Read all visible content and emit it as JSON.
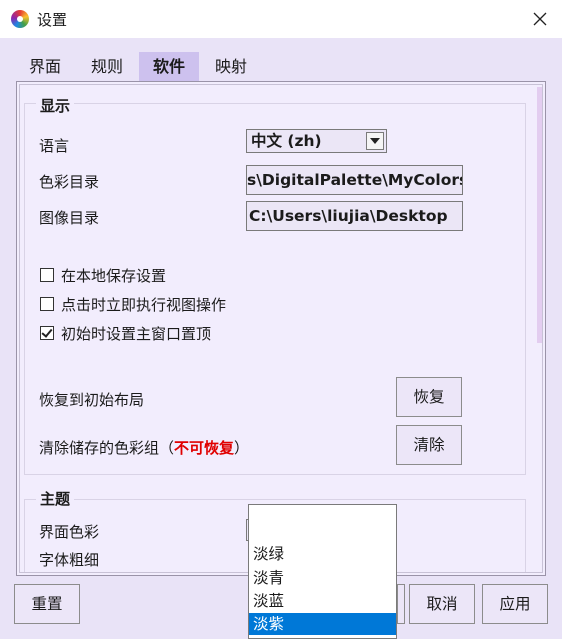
{
  "window": {
    "title": "设置"
  },
  "tabs": [
    {
      "label": "界面"
    },
    {
      "label": "规则"
    },
    {
      "label": "软件",
      "active": true
    },
    {
      "label": "映射"
    }
  ],
  "display_group": {
    "title": "显示",
    "language_label": "语言",
    "language_value": "中文 (zh)",
    "color_dir_label": "色彩目录",
    "color_dir_value": "s\\DigitalPalette\\MyColors",
    "image_dir_label": "图像目录",
    "image_dir_value": "C:\\Users\\liujia\\Desktop",
    "checkboxes": [
      {
        "label": "在本地保存设置",
        "checked": false
      },
      {
        "label": "点击时立即执行视图操作",
        "checked": false
      },
      {
        "label": "初始时设置主窗口置顶",
        "checked": true
      }
    ],
    "restore_label": "恢复到初始布局",
    "restore_button": "恢复",
    "clear_label_prefix": "清除储存的色彩组（",
    "clear_label_warning": "不可恢复",
    "clear_label_suffix": "）",
    "clear_button": "清除",
    "warning_color": "#e00000"
  },
  "theme_group": {
    "title": "主题",
    "ui_color_label": "界面色彩",
    "ui_color_value": "淡紫",
    "font_weight_label": "字体粗细"
  },
  "dropdown": {
    "options": [
      "淡绿",
      "淡青",
      "淡蓝",
      "淡紫"
    ],
    "selected": "淡紫"
  },
  "footer": {
    "reset_button": "重置",
    "cancel_button": "取消",
    "apply_button": "应用"
  },
  "colors": {
    "accent": "#cdc1ee",
    "selection": "#0078d7",
    "background": "#e9e3f7"
  }
}
